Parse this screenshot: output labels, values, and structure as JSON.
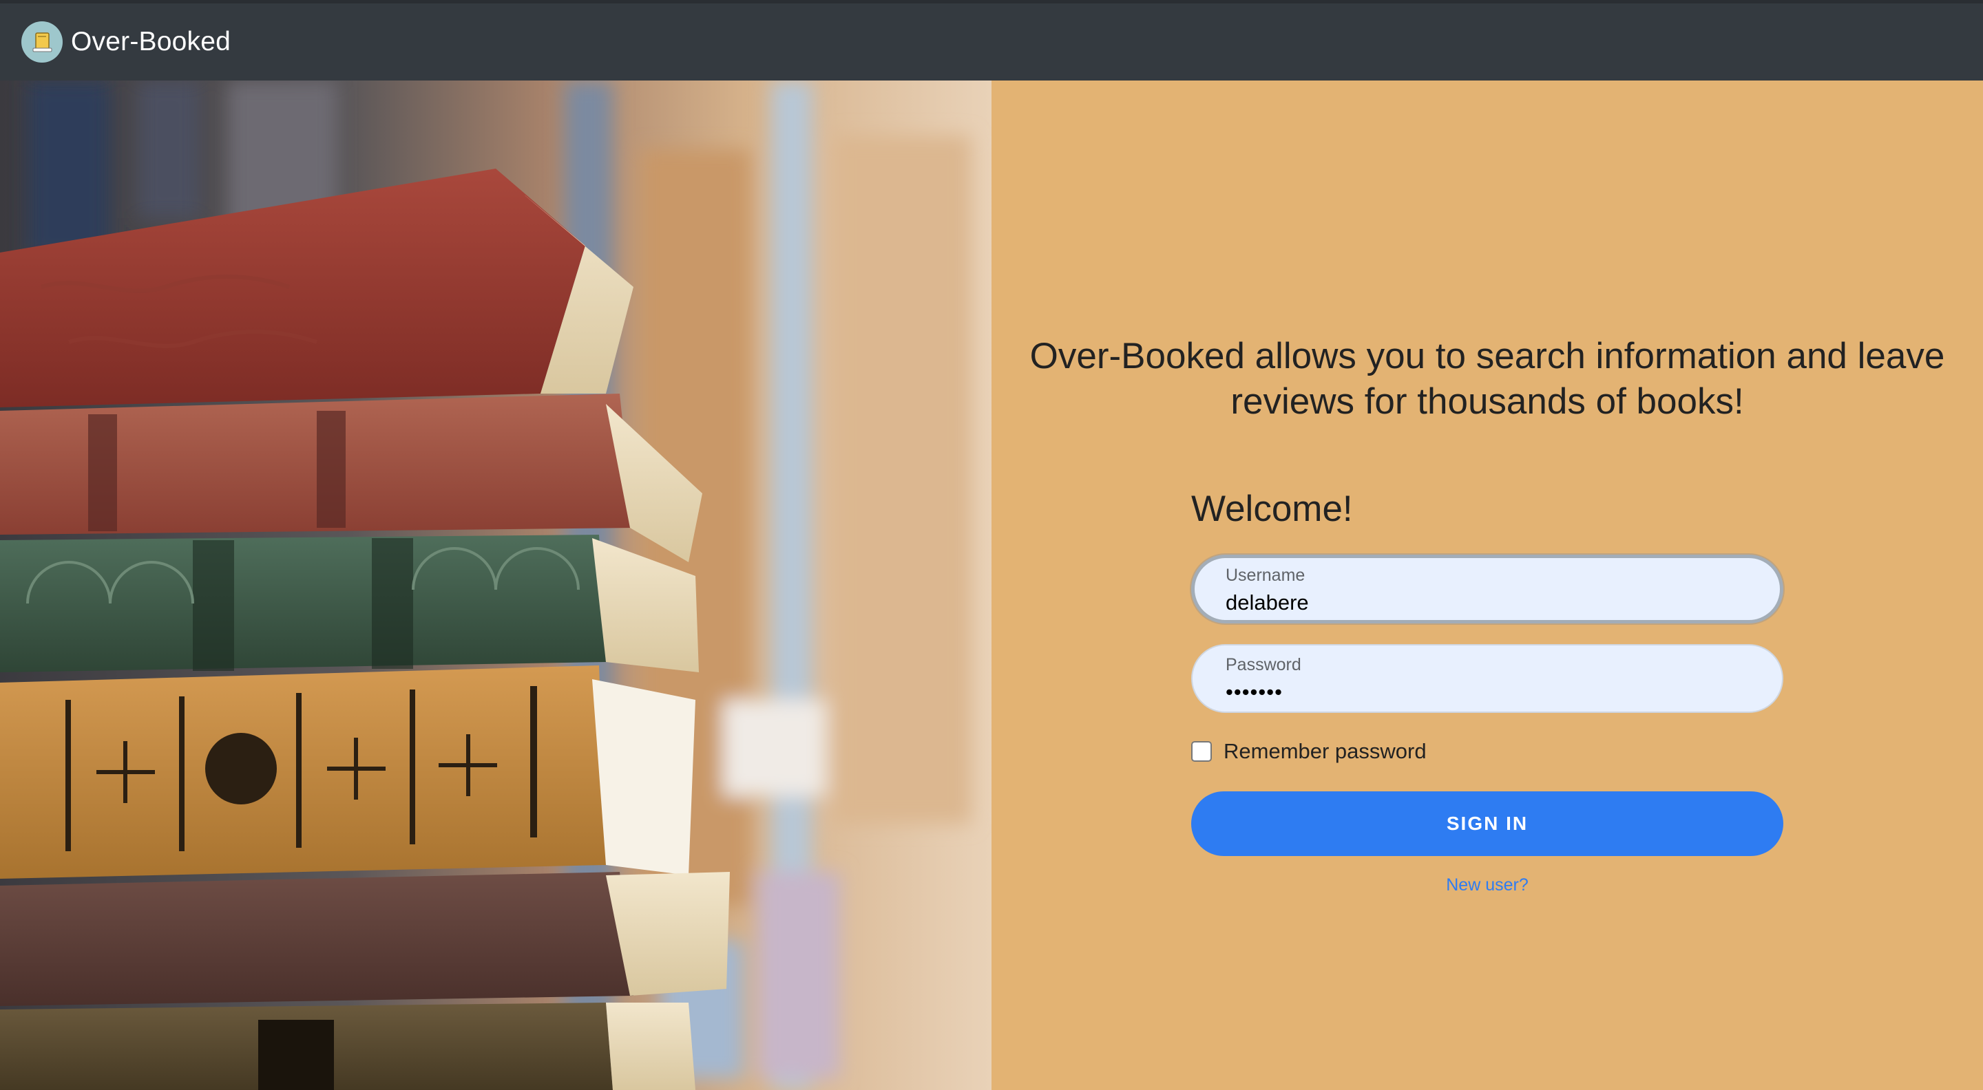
{
  "navbar": {
    "brand_name": "Over-Booked",
    "logo_icon": "book-icon"
  },
  "hero": {
    "image_subject": "stack-of-old-books-icon"
  },
  "main": {
    "tagline": "Over-Booked allows you to search information and leave reviews for thousands of books!",
    "welcome": "Welcome!",
    "username": {
      "label": "Username",
      "value": "delabere"
    },
    "password": {
      "label": "Password",
      "value": "•••••••"
    },
    "remember_label": "Remember password",
    "remember_checked": false,
    "signin_label": "SIGN IN",
    "new_user_link": "New user?"
  },
  "colors": {
    "navbar_bg": "#343a40",
    "panel_bg": "#e3b373",
    "primary": "#2e7cf2",
    "input_bg": "#e8f0fe"
  }
}
